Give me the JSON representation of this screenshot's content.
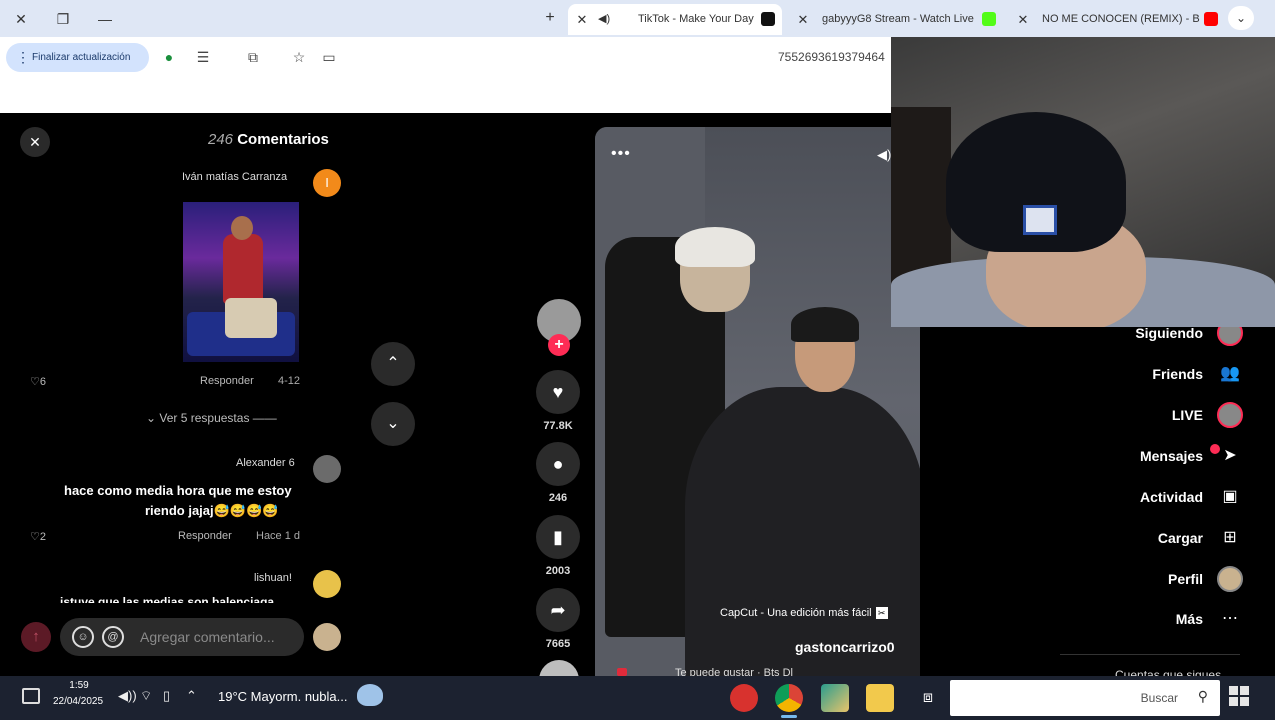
{
  "browser": {
    "tabs": [
      {
        "title": "NO ME CONOCEN (REMIX) - B",
        "favicon_color": "#ff0000"
      },
      {
        "title": "gabyyyG8 Stream - Watch Live",
        "favicon_color": "#53fc18"
      },
      {
        "title": "TikTok - Make Your Day",
        "favicon_color": "#111111",
        "active": true
      }
    ],
    "new_tab": "+",
    "update_button": "Finalizar actualización",
    "url_fragment": "7552693619379464"
  },
  "comments": {
    "title": "Comentarios",
    "count": "246",
    "close": "✕",
    "items": [
      {
        "user": "Iván matías Carranza",
        "avatar_letter": "I",
        "avatar_color": "#f28a1a",
        "date": "4-12",
        "reply": "Responder",
        "likes": "6"
      },
      {
        "user": "Alexander 6",
        "text_line1": "hace como media hora que me estoy",
        "text_line2": "riendo jajaj😅😅😅😅",
        "date": "Hace 1 d",
        "reply": "Responder",
        "likes": "2"
      },
      {
        "user": "lishuan!",
        "text_cut": "istuve que las medias son balenciaga"
      }
    ],
    "view_replies": "Ver 5 respuestas",
    "input_placeholder": "Agregar comentario..."
  },
  "video": {
    "user": "gastoncarrizo0",
    "capcut": "CapCut - Una edición más fácil",
    "caption_cut": "Te puede gustar · Bts Dl",
    "menu": "•••"
  },
  "rail": {
    "likes": "77.8K",
    "comments": "246",
    "saves": "2003",
    "shares": "7665"
  },
  "sidebar": {
    "items": [
      {
        "label": "Siguiendo",
        "icon": "following-icon"
      },
      {
        "label": "Friends",
        "icon": "friends-icon"
      },
      {
        "label": "LIVE",
        "icon": "live-icon"
      },
      {
        "label": "Mensajes",
        "icon": "messages-icon"
      },
      {
        "label": "Actividad",
        "icon": "activity-icon"
      },
      {
        "label": "Cargar",
        "icon": "upload-icon"
      },
      {
        "label": "Perfil",
        "icon": "profile-icon"
      },
      {
        "label": "Más",
        "icon": "more-icon"
      }
    ],
    "cut_text": "Cuentas que sigues"
  },
  "taskbar": {
    "search_placeholder": "Buscar",
    "weather": "19°C  Mayorm. nubla...",
    "time": "1:59",
    "date": "22/04/2025"
  },
  "colors": {
    "accent": "#fe2c55",
    "chrome_tabbar": "#dfe7f5",
    "update_button": "#d3e3fd"
  }
}
